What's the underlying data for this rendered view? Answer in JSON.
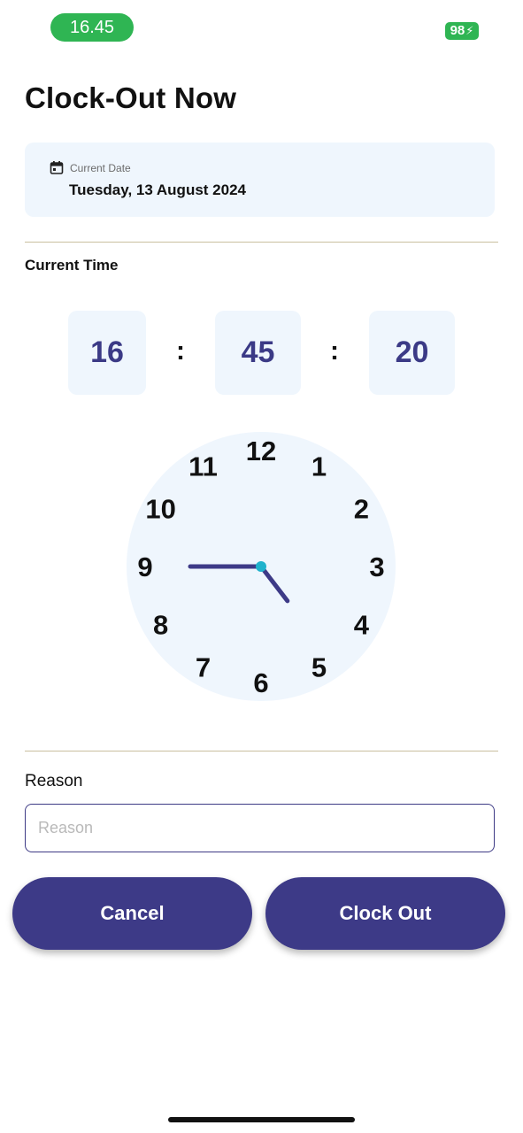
{
  "status_bar": {
    "time": "16.45",
    "battery": "98"
  },
  "page": {
    "title": "Clock-Out Now"
  },
  "date_card": {
    "icon": "calendar-icon",
    "label": "Current Date",
    "value": "Tuesday, 13 August 2024"
  },
  "current_time": {
    "label": "Current Time",
    "hours": "16",
    "minutes": "45",
    "seconds": "20",
    "separator": ":"
  },
  "clock": {
    "numbers": [
      "12",
      "1",
      "2",
      "3",
      "4",
      "5",
      "6",
      "7",
      "8",
      "9",
      "10",
      "11"
    ],
    "hour": 16,
    "minute": 45,
    "face_color": "#eff6fd",
    "hand_color": "#3d3a87",
    "center_color": "#1fb2cc"
  },
  "reason": {
    "label": "Reason",
    "placeholder": "Reason",
    "value": ""
  },
  "actions": {
    "cancel_label": "Cancel",
    "clock_out_label": "Clock Out"
  },
  "colors": {
    "accent": "#3d3a87",
    "status_green": "#2fb553",
    "card_bg": "#eff6fd"
  }
}
